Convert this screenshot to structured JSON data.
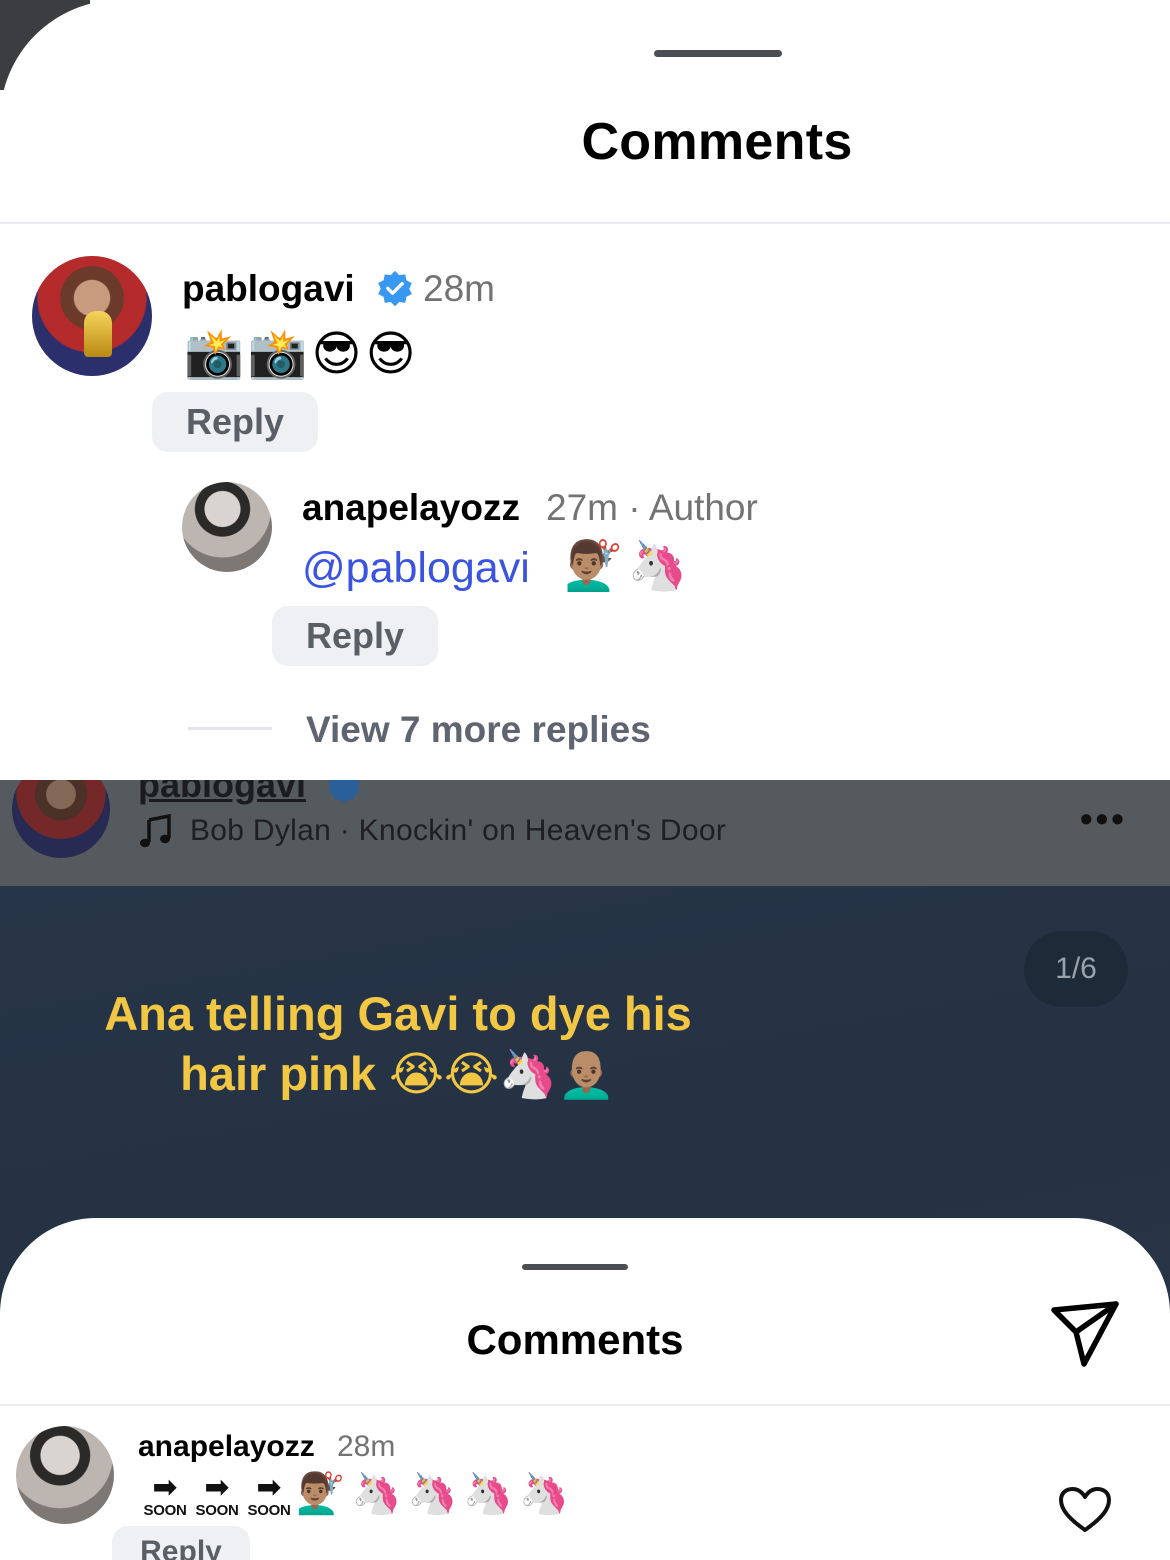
{
  "top_sheet": {
    "title": "Comments",
    "comment": {
      "username": "pablogavi",
      "time": "28m",
      "emojis": "📸📸😎😎",
      "reply_label": "Reply"
    },
    "reply": {
      "username": "anapelayozz",
      "meta": "27m · Author",
      "mention": "@pablogavi",
      "emojis": "💇🏽‍♂️🦄",
      "reply_label": "Reply"
    },
    "view_more": "View 7 more replies"
  },
  "post": {
    "username": "pablogavi",
    "song": "Bob Dylan · Knockin' on Heaven's Door",
    "more": "•••",
    "counter": "1/6",
    "caption_line1": "Ana telling Gavi to dye his",
    "caption_line2": "hair pink 😭😭🦄👨🏽‍🦲"
  },
  "bottom_sheet": {
    "title": "Comments",
    "comment": {
      "username": "anapelayozz",
      "time": "28m",
      "soon_labels": [
        "SOON",
        "SOON",
        "SOON"
      ],
      "emojis": "💇🏽‍♂️🦄🦄🦄🦄",
      "reply_label": "Reply"
    }
  },
  "colors": {
    "mention": "#3a54e0",
    "caption": "#f1c744",
    "verified": "#3897f0",
    "dark_bg": "#263447"
  }
}
